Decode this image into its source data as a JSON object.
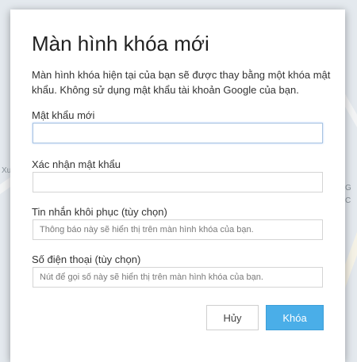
{
  "background": {
    "map_labels": [
      "Xu",
      "G",
      "C"
    ]
  },
  "dialog": {
    "title": "Màn hình khóa mới",
    "description": "Màn hình khóa hiện tại của bạn sẽ được thay bằng một khóa mật khẩu. Không sử dụng mật khẩu tài khoản Google của bạn.",
    "fields": {
      "new_password": {
        "label": "Mật khẩu mới",
        "value": "",
        "placeholder": ""
      },
      "confirm_password": {
        "label": "Xác nhận mật khẩu",
        "value": "",
        "placeholder": ""
      },
      "recovery_message": {
        "label": "Tin nhắn khôi phục (tùy chọn)",
        "value": "",
        "placeholder": "Thông báo này sẽ hiển thị trên màn hình khóa của bạn."
      },
      "phone_number": {
        "label": "Số điện thoại (tùy chọn)",
        "value": "",
        "placeholder": "Nút để gọi số này sẽ hiển thị trên màn hình khóa của bạn."
      }
    },
    "buttons": {
      "cancel": "Hủy",
      "lock": "Khóa"
    },
    "colors": {
      "primary": "#4aaee8",
      "focus_border": "#a9c4e0"
    }
  }
}
